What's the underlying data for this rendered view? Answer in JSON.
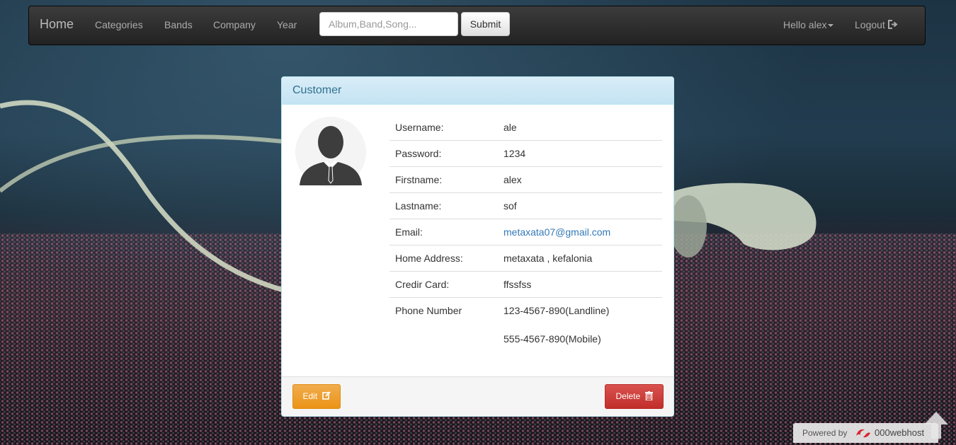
{
  "navbar": {
    "brand": "Home",
    "links": [
      "Categories",
      "Bands",
      "Company",
      "Year"
    ],
    "search_placeholder": "Album,Band,Song...",
    "submit_label": "Submit",
    "user_greeting": "Hello alex",
    "logout_label": "Logout"
  },
  "panel": {
    "title": "Customer",
    "rows": [
      {
        "label": "Username:",
        "value": "ale"
      },
      {
        "label": "Password:",
        "value": "1234"
      },
      {
        "label": "Firstname:",
        "value": "alex"
      },
      {
        "label": "Lastname:",
        "value": "sof"
      },
      {
        "label": "Email:",
        "value": "metaxata07@gmail.com"
      },
      {
        "label": "Home Address:",
        "value": "metaxata , kefalonia"
      },
      {
        "label": "Credir Card:",
        "value": "ffssfss"
      },
      {
        "label": "Phone Number",
        "value": "123-4567-890(Landline)",
        "value2": "555-4567-890(Mobile)"
      }
    ],
    "edit_label": "Edit",
    "delete_label": "Delete"
  },
  "footer": {
    "powered_by": "Powered by",
    "host_name": "000webhost"
  },
  "colors": {
    "panel_heading_text": "#31708f",
    "edit_button": "#f0ad4e",
    "delete_button": "#d9534f",
    "link": "#337ab7"
  }
}
